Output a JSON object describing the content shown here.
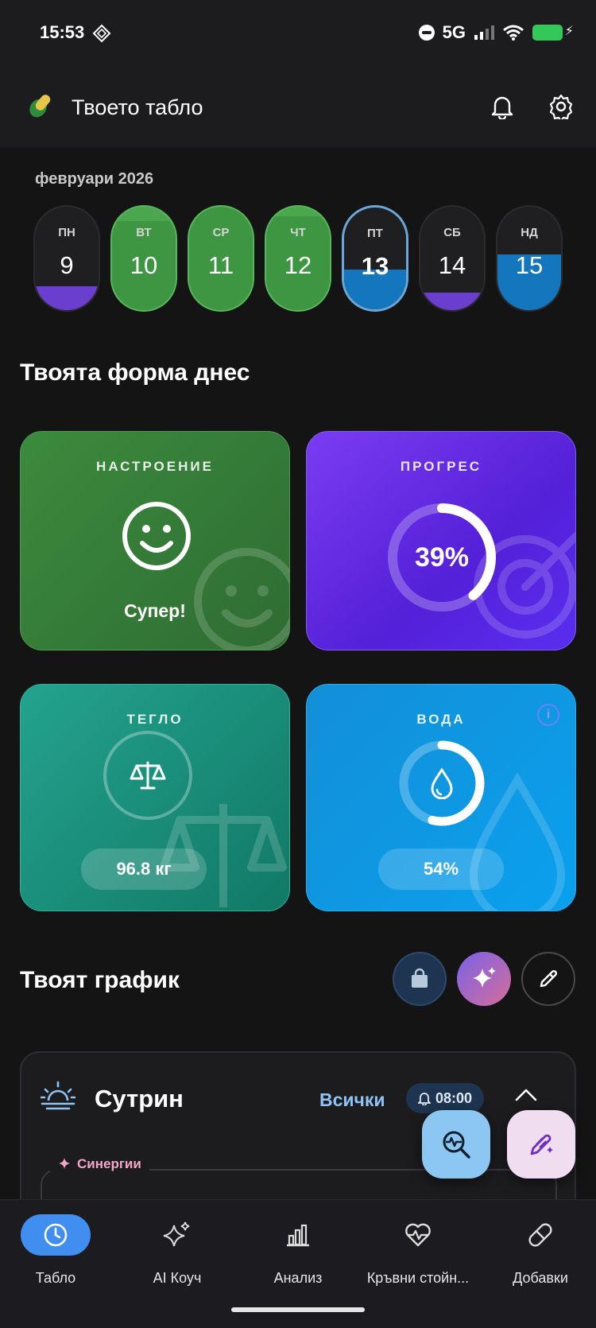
{
  "status_bar": {
    "time": "15:53",
    "network": "5G"
  },
  "header": {
    "title": "Твоето табло"
  },
  "calendar": {
    "month": "февруари 2026",
    "days": [
      {
        "name": "ПН",
        "num": "9"
      },
      {
        "name": "ВТ",
        "num": "10"
      },
      {
        "name": "СР",
        "num": "11"
      },
      {
        "name": "ЧТ",
        "num": "12"
      },
      {
        "name": "ПТ",
        "num": "13"
      },
      {
        "name": "СБ",
        "num": "14"
      },
      {
        "name": "НД",
        "num": "15"
      }
    ]
  },
  "today": {
    "title": "Твоята форма днес",
    "mood": {
      "label": "НАСТРОЕНИЕ",
      "value": "Супер!"
    },
    "progress": {
      "label": "ПРОГРЕС",
      "value": "39%",
      "fraction": 0.39
    },
    "weight": {
      "label": "ТЕГЛО",
      "value": "96.8 кг"
    },
    "water": {
      "label": "ВОДА",
      "value": "54%",
      "fraction": 0.54
    }
  },
  "schedule": {
    "title": "Твоят график",
    "morning": {
      "title": "Сутрин",
      "all_link": "Всички",
      "time": "08:00",
      "synergy_label": "Синергии"
    }
  },
  "nav": [
    {
      "label": "Табло",
      "icon": "clock-icon"
    },
    {
      "label": "AI Коуч",
      "icon": "sparkles-icon"
    },
    {
      "label": "Анализ",
      "icon": "bar-chart-icon"
    },
    {
      "label": "Кръвни стойн...",
      "icon": "heart-pulse-icon"
    },
    {
      "label": "Добавки",
      "icon": "pill-icon"
    }
  ],
  "colors": {
    "mood_card": "#3b8b3d",
    "progress_card": "#6a2ee8",
    "weight_card": "#1c9480",
    "water_card": "#0e96e2",
    "active_nav": "#3f8ef0"
  }
}
